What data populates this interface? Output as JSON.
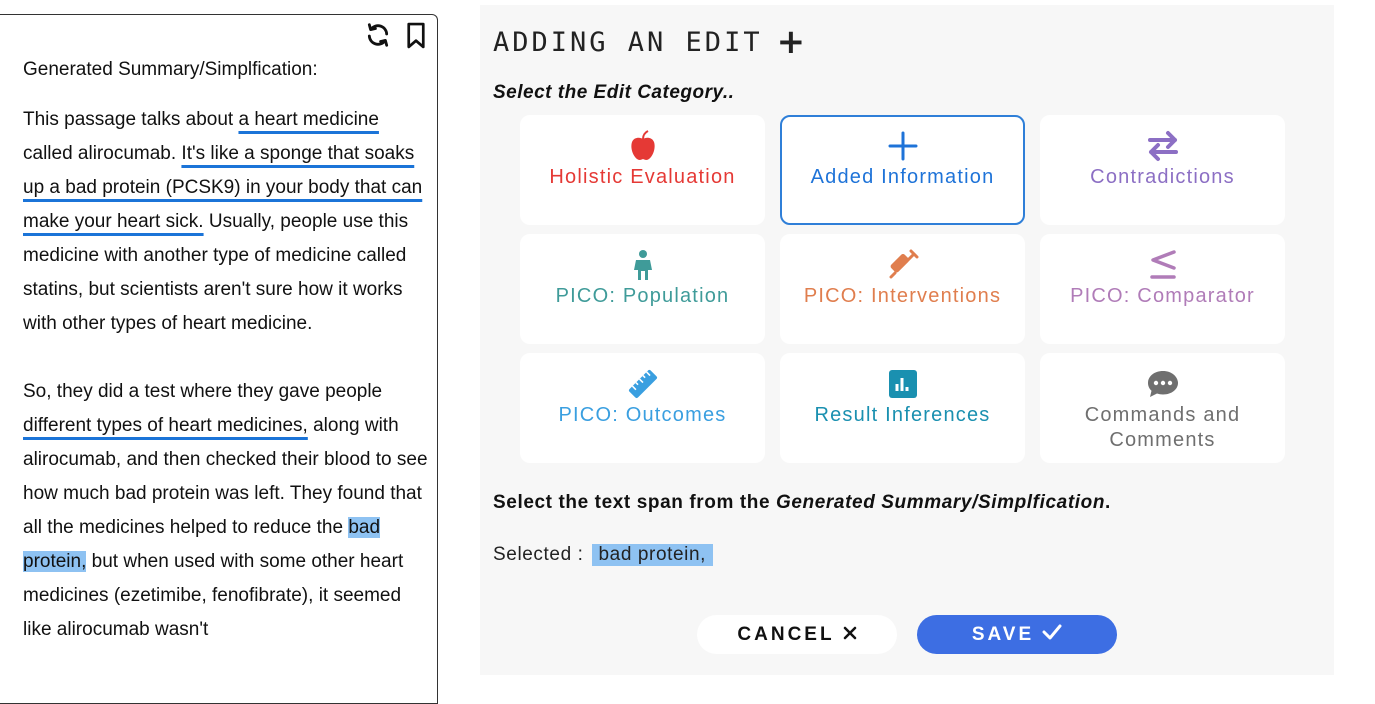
{
  "summary": {
    "title": "Generated Summary/Simplfication:",
    "p1": {
      "s1": "This passage talks about ",
      "u1": "a heart medicine",
      "s2": " called alirocumab. ",
      "u2": "It's like a sponge that soaks up a bad protein (PCSK9) in your body that can make your heart sick.",
      "s3": " Usually, people use this medicine with another type of medicine called statins, but scientists aren't sure how it works with other types of heart medicine."
    },
    "p2": {
      "s1": "So, they did a test where they gave people ",
      "u1": "different types of heart medicines,",
      "s2": " along with alirocumab, and then checked their blood to see how much bad protein was left. They found that all the medicines helped to reduce the ",
      "h1": "bad protein,",
      "s3": " but when used with some other heart medicines (ezetimibe, fenofibrate), it seemed like alirocumab wasn't"
    },
    "icons": [
      "refresh-icon",
      "bookmark-icon"
    ]
  },
  "editor": {
    "title": "ADDING AN EDIT",
    "category_prompt": "Select the Edit Category..",
    "categories": [
      {
        "label": "Holistic Evaluation",
        "color": "#e53935",
        "icon": "apple-icon"
      },
      {
        "label": "Added Information",
        "color": "#1e73d8",
        "icon": "plus-icon",
        "selected": true
      },
      {
        "label": "Contradictions",
        "color": "#8c6fc4",
        "icon": "arrows-swap-icon"
      },
      {
        "label": "PICO: Population",
        "color": "#3f9b99",
        "icon": "person-icon"
      },
      {
        "label": "PICO: Interventions",
        "color": "#e07e4e",
        "icon": "syringe-icon"
      },
      {
        "label": "PICO: Comparator",
        "color": "#b07cb8",
        "icon": "less-equal-icon"
      },
      {
        "label": "PICO: Outcomes",
        "color": "#3a9fe0",
        "icon": "ruler-icon"
      },
      {
        "label": "Result Inferences",
        "color": "#1a90b0",
        "icon": "bar-chart-icon"
      },
      {
        "label": "Commands and Comments",
        "color": "#6f6f6f",
        "icon": "comment-icon"
      }
    ],
    "span_prompt_pre": "Select the text span from the ",
    "span_prompt_em": "Generated Summary/Simplfication",
    "span_prompt_post": ".",
    "selected_label": "Selected :",
    "selected_value": "bad protein,",
    "cancel_label": "CANCEL",
    "save_label": "SAVE"
  }
}
